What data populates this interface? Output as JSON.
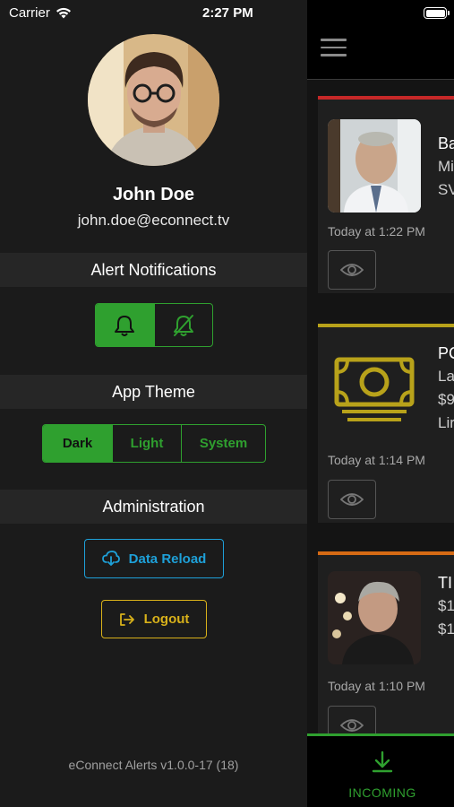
{
  "status_bar": {
    "carrier": "Carrier",
    "time": "2:27 PM"
  },
  "profile": {
    "name": "John Doe",
    "email": "john.doe@econnect.tv"
  },
  "alert_notifications": {
    "header": "Alert Notifications",
    "options": [
      {
        "icon": "bell-icon",
        "selected": true
      },
      {
        "icon": "bell-off-icon",
        "selected": false
      }
    ]
  },
  "app_theme": {
    "header": "App Theme",
    "options": [
      {
        "label": "Dark",
        "selected": true
      },
      {
        "label": "Light",
        "selected": false
      },
      {
        "label": "System",
        "selected": false
      }
    ]
  },
  "administration": {
    "header": "Administration",
    "data_reload_label": "Data Reload",
    "logout_label": "Logout"
  },
  "version": "eConnect Alerts v1.0.0-17 (18)",
  "alerts": [
    {
      "stripe_color": "#c62828",
      "title": "Ba",
      "lines": [
        "Mi",
        "SV"
      ],
      "time": "Today at 1:22 PM",
      "icon": "person-photo"
    },
    {
      "stripe_color": "#b8a21a",
      "title": "PC",
      "lines": [
        "La",
        "$9",
        "Lir"
      ],
      "time": "Today at 1:14 PM",
      "icon": "money-icon"
    },
    {
      "stripe_color": "#d56a14",
      "title": "TI",
      "lines": [
        "$1",
        "$1"
      ],
      "time": "Today at 1:10 PM",
      "icon": "person-photo"
    }
  ],
  "bottom_tab": {
    "label": "INCOMING"
  },
  "colors": {
    "accent_green": "#2fa02f",
    "reload_blue": "#1ea0d8",
    "logout_yellow": "#d8b11a"
  }
}
